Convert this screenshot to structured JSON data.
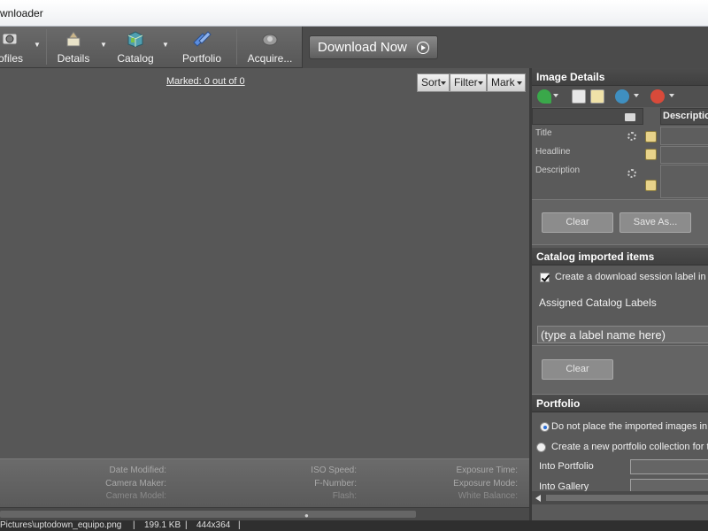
{
  "window": {
    "title": "wnloader"
  },
  "toolbar": {
    "items": [
      {
        "label": "ofiles"
      },
      {
        "label": "Details"
      },
      {
        "label": "Catalog"
      },
      {
        "label": "Portfolio"
      },
      {
        "label": "Acquire..."
      }
    ],
    "download_label": "Download Now"
  },
  "content": {
    "marked_link": "Marked: 0 out of 0",
    "sort_label": "Sort",
    "filter_label": "Filter",
    "mark_label": "Mark"
  },
  "info_fields": {
    "date_modified": "Date Modified:",
    "camera_maker": "Camera Maker:",
    "camera_model": "Camera Model:",
    "iso_speed": "ISO Speed:",
    "f_number": "F-Number:",
    "flash": "Flash:",
    "exposure_time": "Exposure Time:",
    "exposure_mode": "Exposure Mode:",
    "white_balance": "White Balance:"
  },
  "status": {
    "path": "Pictures\\uptodown_equipo.png",
    "size": "199.1 KB",
    "dimensions": "444x364",
    "sep": "|"
  },
  "image_details": {
    "header": "Image Details",
    "column_header": "Description",
    "fields": [
      "Title",
      "Headline",
      "Description"
    ],
    "clear_label": "Clear",
    "save_as_label": "Save As..."
  },
  "catalog": {
    "header": "Catalog imported items",
    "checkbox_label": "Create a download session label in the",
    "assigned_label": "Assigned Catalog Labels",
    "label_input": "(type a label name here)",
    "clear_label": "Clear"
  },
  "portfolio": {
    "header": "Portfolio",
    "radio1": "Do not place the imported images in a p",
    "radio2": "Create a new portfolio collection for the",
    "into_portfolio": "Into Portfolio",
    "into_gallery": "Into Gallery"
  }
}
